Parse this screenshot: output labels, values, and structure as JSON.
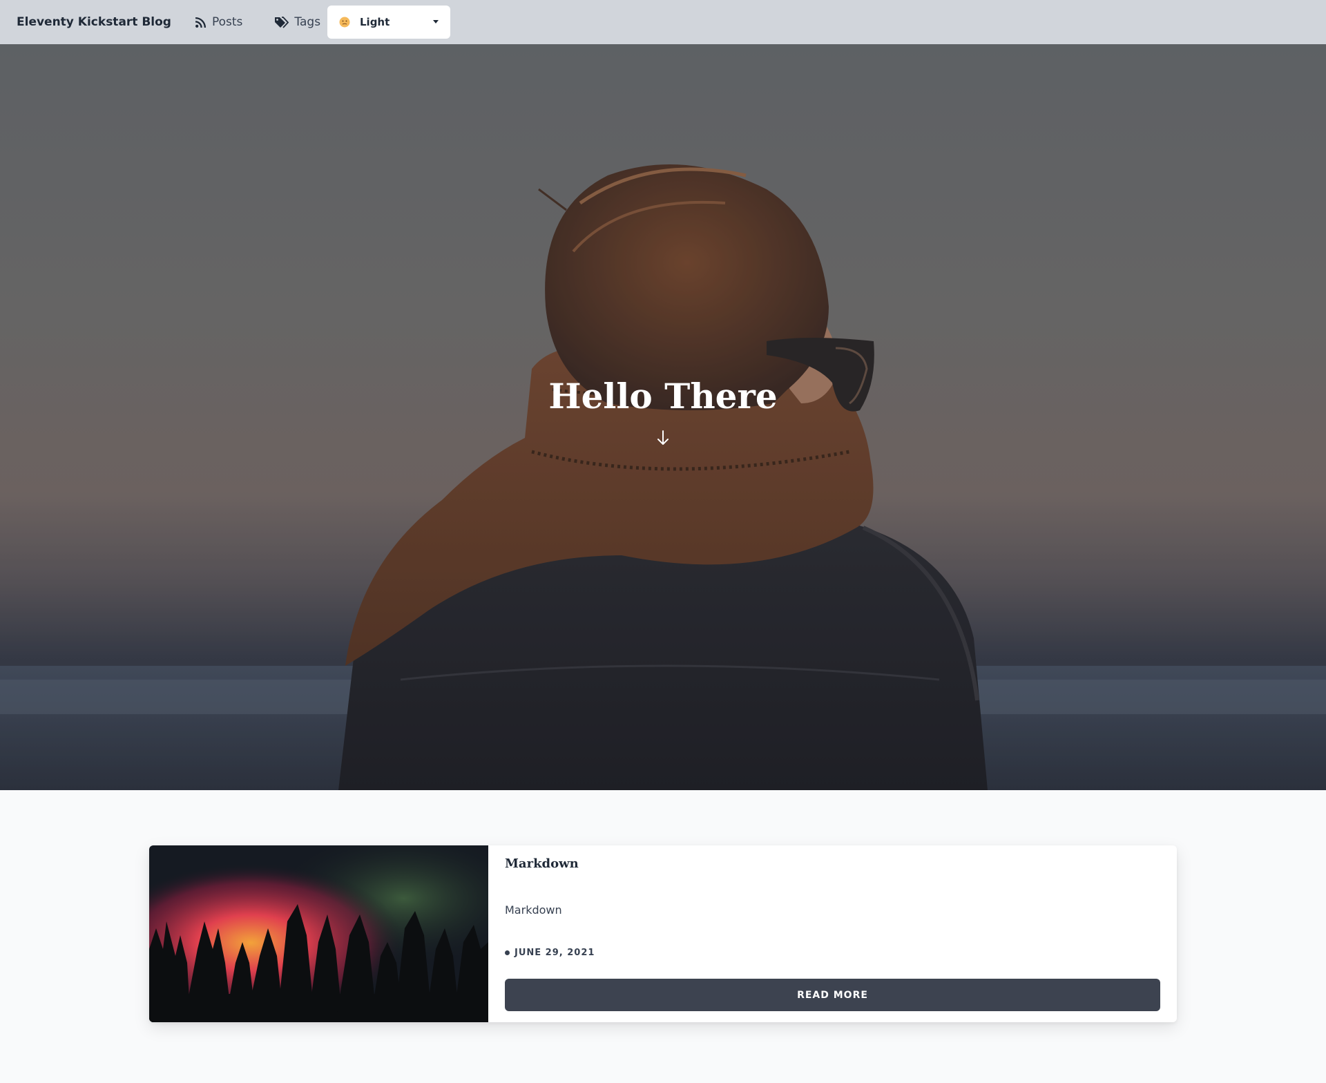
{
  "navbar": {
    "brand": "Eleventy Kickstart Blog",
    "links": [
      {
        "label": "Posts",
        "icon": "rss-icon"
      },
      {
        "label": "Tags",
        "icon": "tags-icon"
      }
    ],
    "theme_select": {
      "value": "Light",
      "icon": "face-icon"
    }
  },
  "hero": {
    "title": "Hello There",
    "scroll_icon": "arrow-down-icon"
  },
  "posts": [
    {
      "title": "Markdown",
      "excerpt": "Markdown",
      "date": "JUNE 29, 2021",
      "button_label": "READ MORE"
    }
  ],
  "colors": {
    "navbar_bg": "#d1d5db",
    "page_bg": "#f9fafb",
    "button_bg": "#3d4350"
  }
}
